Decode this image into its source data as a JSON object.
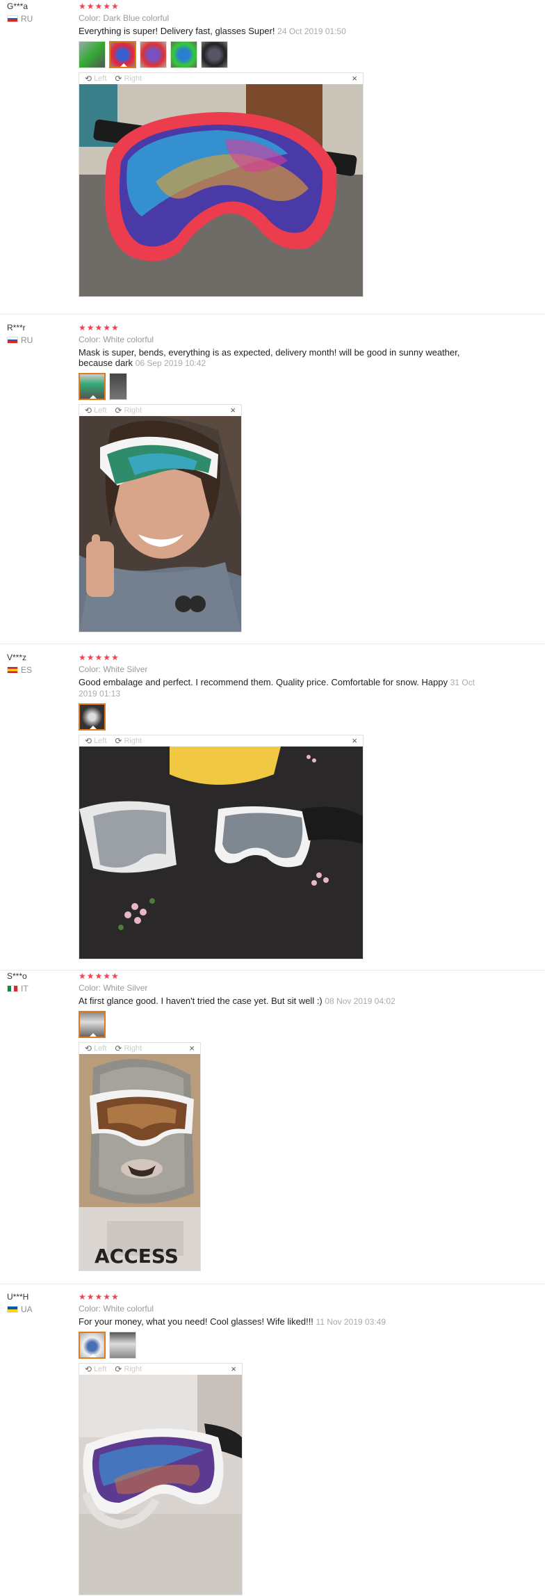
{
  "viewer": {
    "left_label": "Left",
    "right_label": "Right",
    "close_label": "×"
  },
  "reviews": [
    {
      "user": "G***a",
      "country": "RU",
      "rating": 5,
      "color": "Color: Dark Blue colorful",
      "text": "Everything is super! Delivery fast, glasses Super!",
      "date": "24 Oct 2019 01:50"
    },
    {
      "user": "R***r",
      "country": "RU",
      "rating": 5,
      "color": "Color: White colorful",
      "text": "Mask is super, bends, everything is as expected, delivery month! will be good in sunny weather, because dark",
      "date": "06 Sep 2019 10:42"
    },
    {
      "user": "V***z",
      "country": "ES",
      "rating": 5,
      "color": "Color: White Silver",
      "text": "Good embalage and perfect. I recommend them. Quality price. Comfortable for snow. Happy",
      "date": "31 Oct 2019 01:13"
    },
    {
      "user": "S***o",
      "country": "IT",
      "rating": 5,
      "color": "Color: White Silver",
      "text": "At first glance good. I haven't tried the case yet. But sit well :)",
      "date": "08 Nov 2019 04:02"
    },
    {
      "user": "U***H",
      "country": "UA",
      "rating": 5,
      "color": "Color: White colorful",
      "text": "For your money, what you need! Cool glasses! Wife liked!!!",
      "date": "11 Nov 2019 03:49"
    }
  ],
  "stars_glyph": "★★★★★",
  "colors": {
    "star": "#f0424f",
    "selected_border": "#e07a1f"
  }
}
